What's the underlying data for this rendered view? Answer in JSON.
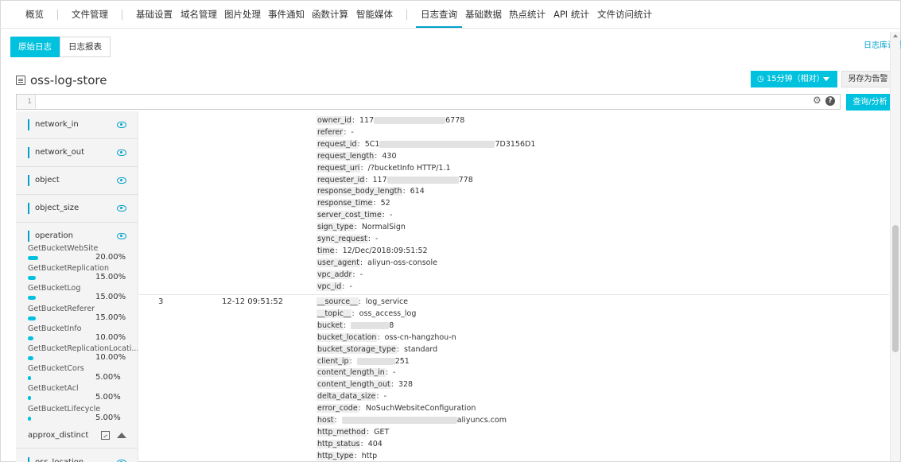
{
  "nav": {
    "items": [
      {
        "label": "概览",
        "active": false
      },
      {
        "label": "文件管理",
        "active": false
      },
      {
        "label": "基础设置",
        "active": false
      },
      {
        "label": "域名管理",
        "active": false
      },
      {
        "label": "图片处理",
        "active": false
      },
      {
        "label": "事件通知",
        "active": false
      },
      {
        "label": "函数计算",
        "active": false
      },
      {
        "label": "智能媒体",
        "active": false
      },
      {
        "label": "日志查询",
        "active": true
      },
      {
        "label": "基础数据",
        "active": false
      },
      {
        "label": "热点统计",
        "active": false
      },
      {
        "label": "API 统计",
        "active": false
      },
      {
        "label": "文件访问统计",
        "active": false
      }
    ],
    "accent_color": "#00c1de"
  },
  "subtabs": {
    "raw": "原始日志",
    "report": "日志报表"
  },
  "settings_link": "日志库设置",
  "logstore": {
    "title": "oss-log-store",
    "time_button": "15分钟（相对）",
    "alert_button": "另存为告警"
  },
  "query": {
    "line_number": "1",
    "value": "",
    "submit": "查询/分析"
  },
  "fields": {
    "items": [
      {
        "name": "network_in"
      },
      {
        "name": "network_out"
      },
      {
        "name": "object"
      },
      {
        "name": "object_size"
      },
      {
        "name": "operation"
      }
    ],
    "operation_values": [
      {
        "label": "GetBucketWebSite",
        "percent": "20.00%",
        "fraction": 0.2
      },
      {
        "label": "GetBucketReplication",
        "percent": "15.00%",
        "fraction": 0.15
      },
      {
        "label": "GetBucketLog",
        "percent": "15.00%",
        "fraction": 0.15
      },
      {
        "label": "GetBucketReferer",
        "percent": "15.00%",
        "fraction": 0.15
      },
      {
        "label": "GetBucketInfo",
        "percent": "10.00%",
        "fraction": 0.1
      },
      {
        "label": "GetBucketReplicationLocati...",
        "percent": "10.00%",
        "fraction": 0.1
      },
      {
        "label": "GetBucketCors",
        "percent": "5.00%",
        "fraction": 0.05
      },
      {
        "label": "GetBucketAcl",
        "percent": "5.00%",
        "fraction": 0.05
      },
      {
        "label": "GetBucketLifecycle",
        "percent": "5.00%",
        "fraction": 0.05
      }
    ],
    "approx_distinct": "approx_distinct",
    "next_field": "oss_location"
  },
  "logs": {
    "first_entry": [
      {
        "key": "owner_id",
        "value": "117",
        "suffix": "6778"
      },
      {
        "key": "referer",
        "value": "-"
      },
      {
        "key": "request_id",
        "value": "5C1",
        "suffix": "7D3156D1"
      },
      {
        "key": "request_length",
        "value": "430"
      },
      {
        "key": "request_uri",
        "value": "/?bucketInfo HTTP/1.1"
      },
      {
        "key": "requester_id",
        "value": "117",
        "suffix": "778"
      },
      {
        "key": "response_body_length",
        "value": "614"
      },
      {
        "key": "response_time",
        "value": "52"
      },
      {
        "key": "server_cost_time",
        "value": "-"
      },
      {
        "key": "sign_type",
        "value": "NormalSign"
      },
      {
        "key": "sync_request",
        "value": "-"
      },
      {
        "key": "time",
        "value": "12/Dec/2018:09:51:52"
      },
      {
        "key": "user_agent",
        "value": "aliyun-oss-console"
      },
      {
        "key": "vpc_addr",
        "value": "-"
      },
      {
        "key": "vpc_id",
        "value": "-"
      }
    ],
    "second_entry": {
      "index": "3",
      "time": "12-12 09:51:52",
      "fields": [
        {
          "key": "__source__",
          "value": "log_service"
        },
        {
          "key": "__topic__",
          "value": "oss_access_log"
        },
        {
          "key": "bucket",
          "value": "",
          "suffix": "8"
        },
        {
          "key": "bucket_location",
          "value": "oss-cn-hangzhou-n"
        },
        {
          "key": "bucket_storage_type",
          "value": "standard"
        },
        {
          "key": "client_ip",
          "value": "",
          "suffix": "251"
        },
        {
          "key": "content_length_in",
          "value": "-"
        },
        {
          "key": "content_length_out",
          "value": "328"
        },
        {
          "key": "delta_data_size",
          "value": "-"
        },
        {
          "key": "error_code",
          "value": "NoSuchWebsiteConfiguration"
        },
        {
          "key": "host",
          "value": "",
          "suffix": "aliyuncs.com"
        },
        {
          "key": "http_method",
          "value": "GET"
        },
        {
          "key": "http_status",
          "value": "404"
        },
        {
          "key": "http_type",
          "value": "http"
        }
      ]
    }
  }
}
